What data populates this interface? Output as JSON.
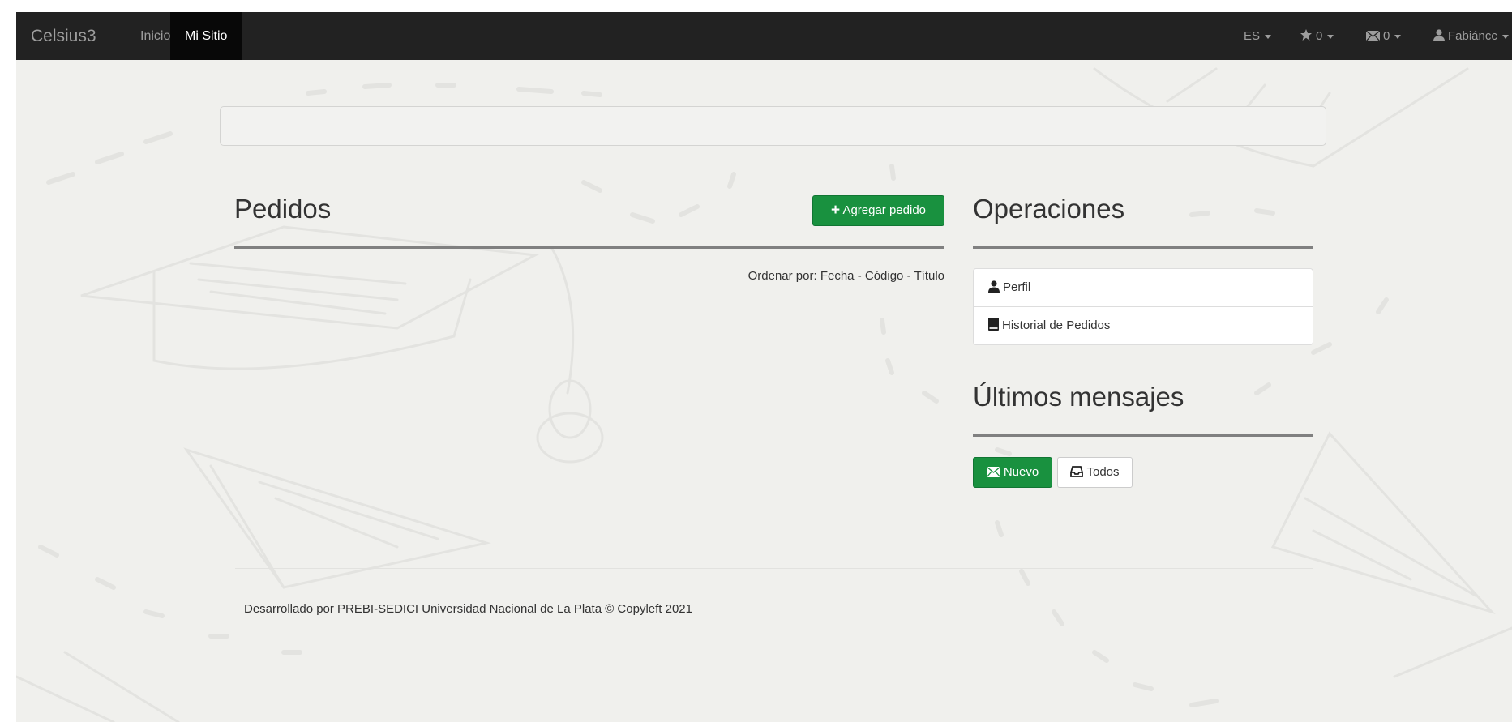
{
  "navbar": {
    "brand": "Celsius3",
    "links": {
      "inicio": "Inicio",
      "mi_sitio": "Mi Sitio"
    },
    "language": "ES",
    "favorites_count": "0",
    "messages_count": "0",
    "user_name": "Fabiáncc",
    "icons": {
      "favorites": "star-icon",
      "messages": "envelope-icon",
      "user": "user-icon"
    }
  },
  "pedidos": {
    "title": "Pedidos",
    "add_button": "Agregar pedido",
    "sort_label": "Ordenar por:",
    "sort_options": [
      "Fecha",
      "Código",
      "Título"
    ],
    "sort_separator": "-"
  },
  "operaciones": {
    "title": "Operaciones",
    "items": [
      {
        "label": "Perfil",
        "icon": "user-icon"
      },
      {
        "label": "Historial de Pedidos",
        "icon": "book-icon"
      }
    ]
  },
  "mensajes": {
    "title": "Últimos mensajes",
    "new_button": "Nuevo",
    "all_button": "Todos"
  },
  "footer": {
    "text": "Desarrollado por PREBI-SEDICI Universidad Nacional de La Plata © Copyleft 2021"
  },
  "colors": {
    "navbar": "#222222",
    "navbar_active": "#080808",
    "background": "#f0f0ed",
    "success": "#19913f",
    "rule": "#808080"
  }
}
